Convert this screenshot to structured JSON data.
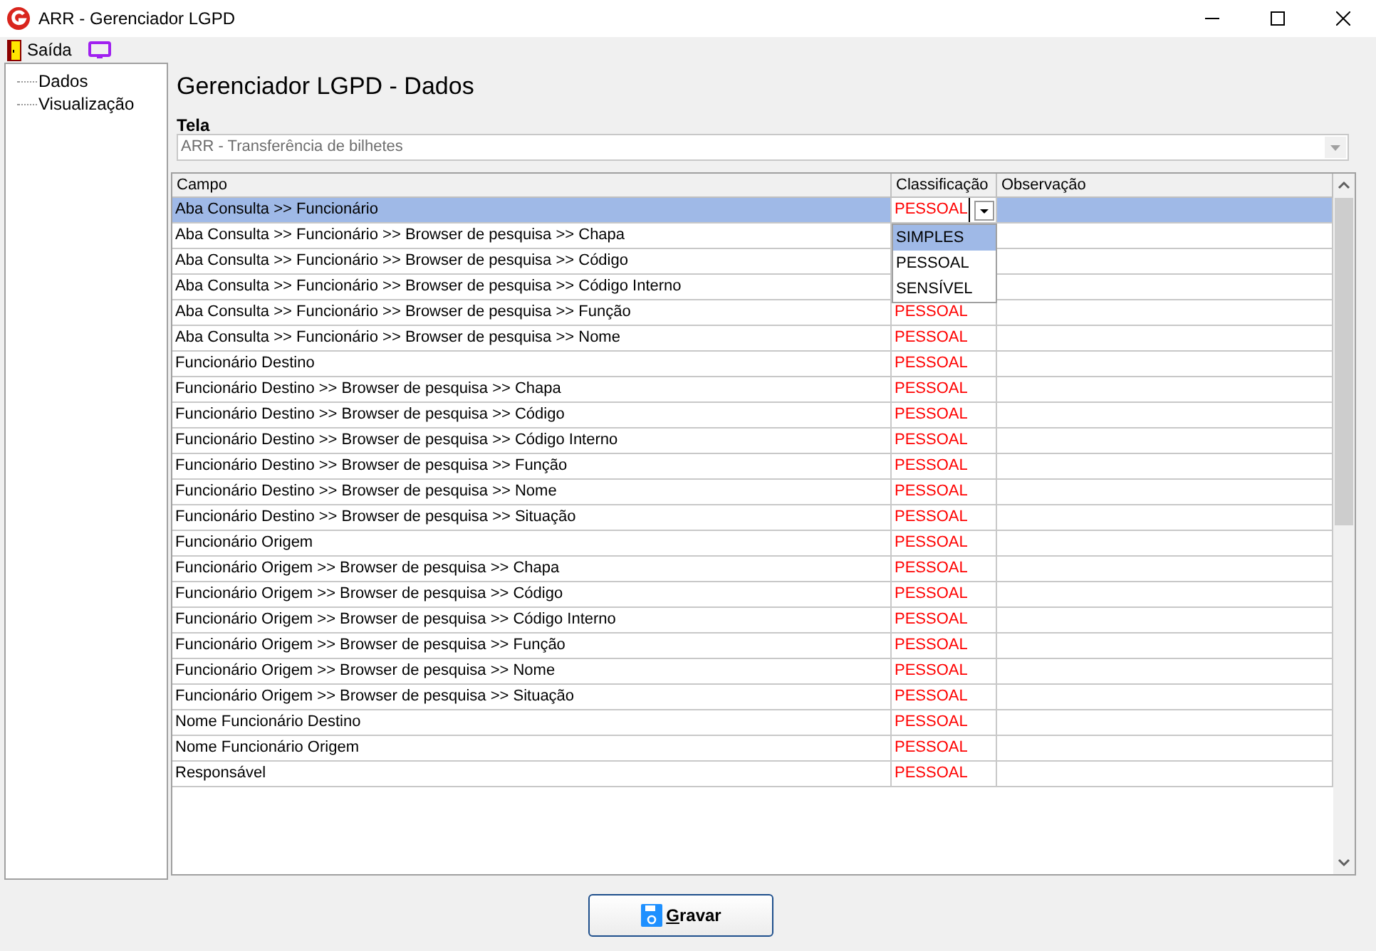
{
  "window": {
    "title": "ARR - Gerenciador LGPD"
  },
  "menu": [
    {
      "label": "Saída",
      "kind": "exit"
    },
    {
      "kind": "monitor"
    }
  ],
  "tree": [
    {
      "label": "Dados",
      "selected": false
    },
    {
      "label": "Visualização",
      "selected": false
    }
  ],
  "page_title": "Gerenciador LGPD - Dados",
  "screen_field": {
    "label": "Tela",
    "value": "ARR - Transferência de bilhetes"
  },
  "table": {
    "columns": [
      "Campo",
      "Classificação",
      "Observação"
    ],
    "rows": [
      {
        "campo": "Aba Consulta >> Funcionário",
        "classificacao": "PESSOAL",
        "selected": true,
        "editing": true
      },
      {
        "campo": "Aba Consulta >> Funcionário >> Browser de pesquisa >> Chapa",
        "selected": false
      },
      {
        "campo": "Aba Consulta >> Funcionário >> Browser de pesquisa >> Código",
        "selected": false
      },
      {
        "campo": "Aba Consulta >> Funcionário >> Browser de pesquisa >> Código Interno",
        "selected": false
      },
      {
        "campo": "Aba Consulta >> Funcionário >> Browser de pesquisa >> Função",
        "classificacao": "PESSOAL",
        "selected": false
      },
      {
        "campo": "Aba Consulta >> Funcionário >> Browser de pesquisa >> Nome",
        "classificacao": "PESSOAL",
        "selected": false
      },
      {
        "campo": "Funcionário Destino",
        "classificacao": "PESSOAL",
        "selected": false
      },
      {
        "campo": "Funcionário Destino >> Browser de pesquisa >> Chapa",
        "classificacao": "PESSOAL",
        "selected": false
      },
      {
        "campo": "Funcionário Destino >> Browser de pesquisa >> Código",
        "classificacao": "PESSOAL",
        "selected": false
      },
      {
        "campo": "Funcionário Destino >> Browser de pesquisa >> Código Interno",
        "classificacao": "PESSOAL",
        "selected": false
      },
      {
        "campo": "Funcionário Destino >> Browser de pesquisa >> Função",
        "classificacao": "PESSOAL",
        "selected": false
      },
      {
        "campo": "Funcionário Destino >> Browser de pesquisa >> Nome",
        "classificacao": "PESSOAL",
        "selected": false
      },
      {
        "campo": "Funcionário Destino >> Browser de pesquisa >> Situação",
        "classificacao": "PESSOAL",
        "selected": false
      },
      {
        "campo": "Funcionário Origem",
        "classificacao": "PESSOAL",
        "selected": false
      },
      {
        "campo": "Funcionário Origem >> Browser de pesquisa >> Chapa",
        "classificacao": "PESSOAL",
        "selected": false
      },
      {
        "campo": "Funcionário Origem >> Browser de pesquisa >> Código",
        "classificacao": "PESSOAL",
        "selected": false
      },
      {
        "campo": "Funcionário Origem >> Browser de pesquisa >> Código Interno",
        "classificacao": "PESSOAL",
        "selected": false
      },
      {
        "campo": "Funcionário Origem >> Browser de pesquisa >> Função",
        "classificacao": "PESSOAL",
        "selected": false
      },
      {
        "campo": "Funcionário Origem >> Browser de pesquisa >> Nome",
        "classificacao": "PESSOAL",
        "selected": false
      },
      {
        "campo": "Funcionário Origem >> Browser de pesquisa >> Situação",
        "classificacao": "PESSOAL",
        "selected": false
      },
      {
        "campo": "Nome Funcionário Destino",
        "classificacao": "PESSOAL",
        "selected": false
      },
      {
        "campo": "Nome Funcionário Origem",
        "classificacao": "PESSOAL",
        "selected": false
      },
      {
        "campo": "Responsável",
        "classificacao": "PESSOAL",
        "selected": false
      }
    ],
    "dropdown_options": [
      {
        "label": "SIMPLES",
        "selected": true
      },
      {
        "label": "PESSOAL",
        "selected": false
      },
      {
        "label": "SENSÍVEL",
        "selected": false
      }
    ]
  },
  "buttons": [
    {
      "label": "Gravar",
      "kind": "save"
    }
  ]
}
